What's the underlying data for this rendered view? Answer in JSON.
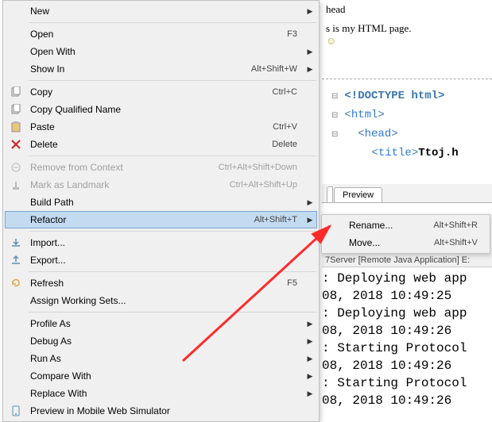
{
  "menu": {
    "new": "New",
    "open": "Open",
    "open_sc": "F3",
    "open_with": "Open With",
    "show_in": "Show In",
    "show_in_sc": "Alt+Shift+W",
    "copy": "Copy",
    "copy_sc": "Ctrl+C",
    "copy_qn": "Copy Qualified Name",
    "paste": "Paste",
    "paste_sc": "Ctrl+V",
    "delete": "Delete",
    "delete_sc": "Delete",
    "remove_ctx": "Remove from Context",
    "remove_ctx_sc": "Ctrl+Alt+Shift+Down",
    "mark_landmark": "Mark as Landmark",
    "mark_landmark_sc": "Ctrl+Alt+Shift+Up",
    "build_path": "Build Path",
    "refactor": "Refactor",
    "refactor_sc": "Alt+Shift+T",
    "import": "Import...",
    "export": "Export...",
    "refresh": "Refresh",
    "refresh_sc": "F5",
    "aws": "Assign Working Sets...",
    "profile_as": "Profile As",
    "debug_as": "Debug As",
    "run_as": "Run As",
    "compare_with": "Compare With",
    "replace_with": "Replace With",
    "preview_sim": "Preview in Mobile Web Simulator"
  },
  "submenu": {
    "rename": "Rename...",
    "rename_sc": "Alt+Shift+R",
    "move": "Move...",
    "move_sc": "Alt+Shift+V"
  },
  "preview": {
    "partial1": "head",
    "partial2": "s is my HTML page.  "
  },
  "source": {
    "doctype": "<!DOCTYPE html>",
    "html": "html",
    "head": "head",
    "title": "title",
    "title_txt": "Ttoj.h"
  },
  "tabs": {
    "preview": "Preview"
  },
  "console": {
    "header": "7Server [Remote Java Application] E:",
    "l1": ": Deploying web app",
    "l2": "08, 2018 10:49:25 ",
    "l3": ": Deploying web app",
    "l4": "08, 2018 10:49:26 ",
    "l5": ": Starting Protocol",
    "l6": "08, 2018 10:49:26 ",
    "l7": ": Starting Protocol",
    "l8": "08, 2018 10:49:26 "
  }
}
